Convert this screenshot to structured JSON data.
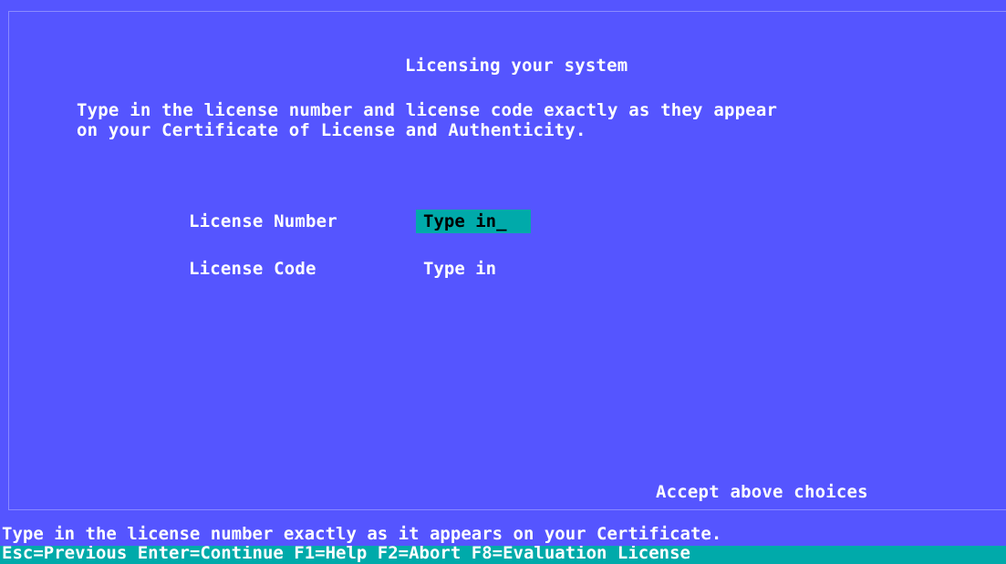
{
  "screen": {
    "title": "Licensing your system",
    "instructions_line1": "Type in the license number and license code exactly as they appear",
    "instructions_line2": "on your Certificate of License and Authenticity."
  },
  "form": {
    "license_number": {
      "label": "License Number",
      "value": "Type in_"
    },
    "license_code": {
      "label": "License Code",
      "value": "Type in"
    }
  },
  "accept_label": "Accept above choices",
  "status": {
    "message": "Type in the license number exactly as it appears on your Certificate.",
    "keys": "Esc=Previous Enter=Continue F1=Help F2=Abort F8=Evaluation License"
  },
  "colors": {
    "background": "#5555ff",
    "highlight": "#00aaaa",
    "text": "#ffffff"
  }
}
